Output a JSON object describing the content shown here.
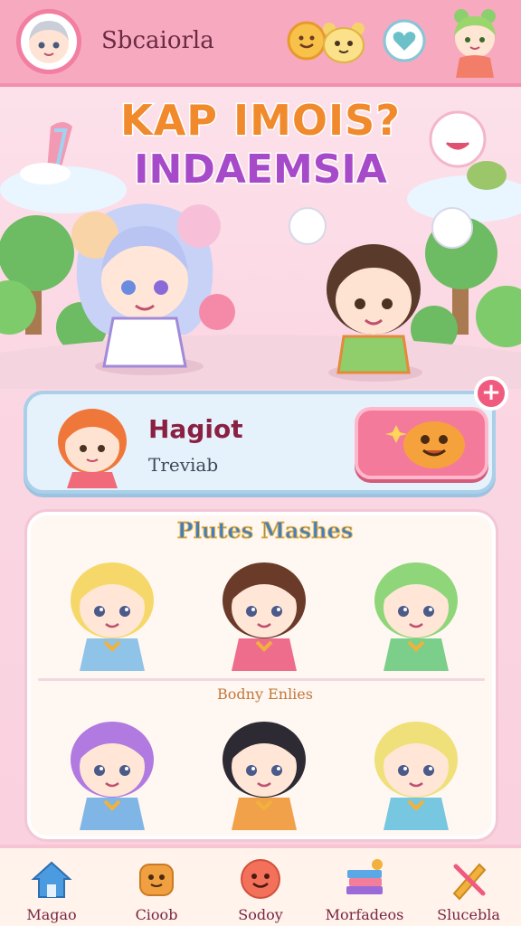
{
  "header": {
    "title": "Sbcaiorla",
    "icons": [
      "profile-avatar",
      "smiley-coin-icon",
      "bear-mascot-icon",
      "heart-bubble-icon",
      "frog-girl-avatar"
    ]
  },
  "hero": {
    "title_line1": "KAP IMOIS?",
    "title_line2": "INDAEMSIA",
    "title_colors": [
      "#f08a2c",
      "#4fb04a",
      "#e94f86",
      "#3f8fd6",
      "#a55bd6"
    ]
  },
  "featured": {
    "name": "Hagiot",
    "subtitle": "Treviab",
    "action_icon": "orange-blob-icon",
    "badge_icon": "plus-icon",
    "badge_symbol": "+"
  },
  "gallery": {
    "title": "Plutes Mashes",
    "subtitle": "Bodny Enlies",
    "rows": [
      [
        {
          "name": "blonde-chibi",
          "hair": "#f6d86a",
          "outfit": "#8fc3e8"
        },
        {
          "name": "brunette-bow-chibi",
          "hair": "#6b3b2a",
          "outfit": "#ef6d8c"
        },
        {
          "name": "green-hair-chibi",
          "hair": "#8fd67a",
          "outfit": "#7ccf8a"
        }
      ],
      [
        {
          "name": "purple-hair-chibi",
          "hair": "#b07ae0",
          "outfit": "#7fb6e6"
        },
        {
          "name": "black-hair-chibi",
          "hair": "#2e2a33",
          "outfit": "#f1a14a"
        },
        {
          "name": "yellow-leaf-chibi",
          "hair": "#efe07a",
          "outfit": "#78c7e0"
        }
      ]
    ]
  },
  "nav": {
    "items": [
      {
        "label": "Magao",
        "icon": "home-icon",
        "color": "#4a9be0"
      },
      {
        "label": "Cioob",
        "icon": "cookie-face-icon",
        "color": "#f0a040"
      },
      {
        "label": "Sodoy",
        "icon": "smile-ball-icon",
        "color": "#f3705a"
      },
      {
        "label": "Morfadeos",
        "icon": "book-stack-icon",
        "color": "#9a6ad8"
      },
      {
        "label": "Slucebla",
        "icon": "pencil-cross-icon",
        "color": "#f2b13c"
      }
    ]
  },
  "colors": {
    "topbar": "#f7a9c0",
    "accent": "#f37a9b",
    "card_bg": "#e6f2fb",
    "text_dark": "#6a2b43"
  }
}
